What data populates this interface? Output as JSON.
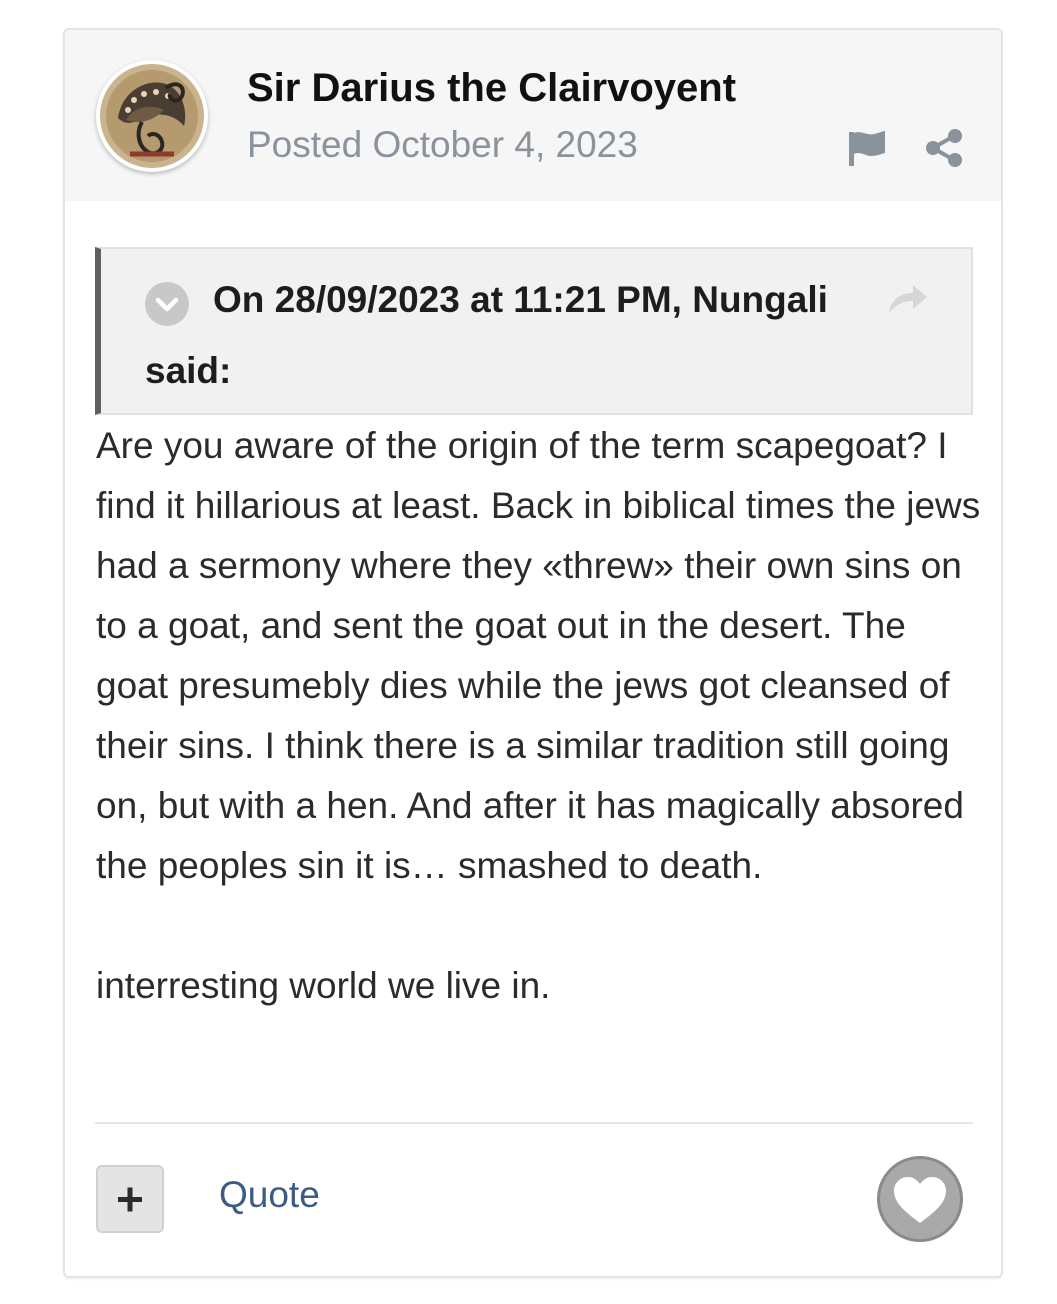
{
  "post": {
    "author": "Sir Darius the Clairvoyent",
    "posted": "Posted October 4, 2023",
    "quote": {
      "citation": "On 28/09/2023 at 11:21 PM, Nungali",
      "said": "said:"
    },
    "body": [
      "Are you aware of the origin of the term scapegoat? I find it hillarious at least. Back in biblical times the jews had a sermony where they «threw» their own sins on to a goat, and sent the goat out in the desert. The goat presumebly dies while the jews got cleansed of their sins. I think there is a similar tradition still going on, but with a hen. And after it has magically absored the peoples sin it is… smashed to death.",
      "interresting world we live in."
    ],
    "actions": {
      "quote_label": "Quote"
    }
  },
  "icons": {
    "flag": "flag-icon",
    "share": "share-icon",
    "quote_toggle": "chevron-down-icon",
    "quote_link": "share-arrow-icon",
    "plus": "plus-icon",
    "like": "heart-icon"
  },
  "colors": {
    "header_bg": "#f6f6f6",
    "quote_bg": "#f1f1f1",
    "quote_border": "#5f5f5f",
    "link": "#3c5b85",
    "meta_text": "#8a929c",
    "like_bg": "#a9a9a9"
  }
}
